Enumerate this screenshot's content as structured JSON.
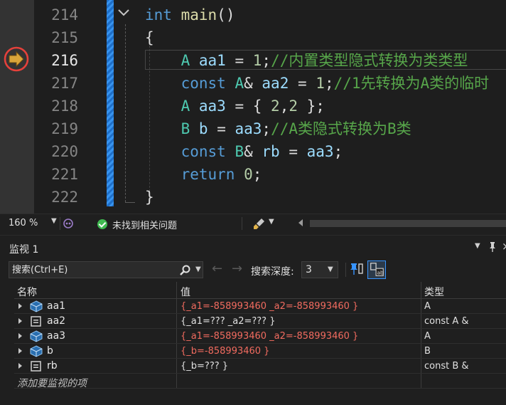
{
  "editor": {
    "lines": [
      {
        "number": "214",
        "tokens": [
          {
            "cls": "kw",
            "t": "int"
          },
          {
            "cls": "pl",
            "t": " "
          },
          {
            "cls": "fn",
            "t": "main"
          },
          {
            "cls": "pl",
            "t": "()"
          }
        ]
      },
      {
        "number": "215",
        "tokens": [
          {
            "cls": "pl",
            "t": "{"
          }
        ]
      },
      {
        "number": "216",
        "tokens": [
          {
            "cls": "pl",
            "t": "    "
          },
          {
            "cls": "ty",
            "t": "A"
          },
          {
            "cls": "pl",
            "t": " "
          },
          {
            "cls": "var",
            "t": "aa1"
          },
          {
            "cls": "pl",
            "t": " = "
          },
          {
            "cls": "num",
            "t": "1"
          },
          {
            "cls": "pl",
            "t": ";"
          },
          {
            "cls": "cm",
            "t": "//内置类型隐式转换为类类型"
          }
        ]
      },
      {
        "number": "217",
        "tokens": [
          {
            "cls": "pl",
            "t": "    "
          },
          {
            "cls": "kw",
            "t": "const"
          },
          {
            "cls": "pl",
            "t": " "
          },
          {
            "cls": "ty",
            "t": "A"
          },
          {
            "cls": "pl",
            "t": "& "
          },
          {
            "cls": "var",
            "t": "aa2"
          },
          {
            "cls": "pl",
            "t": " = "
          },
          {
            "cls": "num",
            "t": "1"
          },
          {
            "cls": "pl",
            "t": ";"
          },
          {
            "cls": "cm",
            "t": "//1先转换为A类的临时"
          }
        ]
      },
      {
        "number": "218",
        "tokens": [
          {
            "cls": "pl",
            "t": "    "
          },
          {
            "cls": "ty",
            "t": "A"
          },
          {
            "cls": "pl",
            "t": " "
          },
          {
            "cls": "var",
            "t": "aa3"
          },
          {
            "cls": "pl",
            "t": " = { "
          },
          {
            "cls": "num",
            "t": "2"
          },
          {
            "cls": "pl",
            "t": ","
          },
          {
            "cls": "num",
            "t": "2"
          },
          {
            "cls": "pl",
            "t": " };"
          }
        ]
      },
      {
        "number": "219",
        "tokens": [
          {
            "cls": "pl",
            "t": "    "
          },
          {
            "cls": "ty",
            "t": "B"
          },
          {
            "cls": "pl",
            "t": " "
          },
          {
            "cls": "var",
            "t": "b"
          },
          {
            "cls": "pl",
            "t": " = "
          },
          {
            "cls": "var",
            "t": "aa3"
          },
          {
            "cls": "pl",
            "t": ";"
          },
          {
            "cls": "cm",
            "t": "//A类隐式转换为B类"
          }
        ]
      },
      {
        "number": "220",
        "tokens": [
          {
            "cls": "pl",
            "t": "    "
          },
          {
            "cls": "kw",
            "t": "const"
          },
          {
            "cls": "pl",
            "t": " "
          },
          {
            "cls": "ty",
            "t": "B"
          },
          {
            "cls": "pl",
            "t": "& "
          },
          {
            "cls": "var",
            "t": "rb"
          },
          {
            "cls": "pl",
            "t": " = "
          },
          {
            "cls": "var",
            "t": "aa3"
          },
          {
            "cls": "pl",
            "t": ";"
          }
        ]
      },
      {
        "number": "221",
        "tokens": [
          {
            "cls": "pl",
            "t": "    "
          },
          {
            "cls": "kw",
            "t": "return"
          },
          {
            "cls": "pl",
            "t": " "
          },
          {
            "cls": "num",
            "t": "0"
          },
          {
            "cls": "pl",
            "t": ";"
          }
        ]
      },
      {
        "number": "222",
        "tokens": [
          {
            "cls": "pl",
            "t": "}"
          }
        ]
      }
    ],
    "current_line": "216"
  },
  "statusbar": {
    "zoom": "160 %",
    "issues": "未找到相关问题"
  },
  "watch": {
    "title": "监视 1",
    "search_placeholder": "搜索(Ctrl+E)",
    "depth_label": "搜索深度:",
    "depth_value": "3",
    "columns": {
      "name": "名称",
      "value": "值",
      "type": "类型"
    },
    "rows": [
      {
        "name": "aa1",
        "icon": "object-icon",
        "value": "{_a1=-858993460 _a2=-858993460 }",
        "changed": true,
        "type": "A"
      },
      {
        "name": "aa2",
        "icon": "reference-icon",
        "value": "{_a1=??? _a2=??? }",
        "changed": false,
        "type": "const A &"
      },
      {
        "name": "aa3",
        "icon": "object-icon",
        "value": "{_a1=-858993460 _a2=-858993460 }",
        "changed": true,
        "type": "A"
      },
      {
        "name": "b",
        "icon": "object-icon",
        "value": "{_b=-858993460 }",
        "changed": true,
        "type": "B"
      },
      {
        "name": "rb",
        "icon": "reference-icon",
        "value": "{_b=??? }",
        "changed": false,
        "type": "const B &"
      }
    ],
    "add_watch": "添加要监视的项"
  },
  "colors": {
    "accent": "#3794ff",
    "changed_value": "#f16b5f",
    "breakpoint_ring": "#e5413b",
    "exec_arrow": "#d9a53a"
  }
}
